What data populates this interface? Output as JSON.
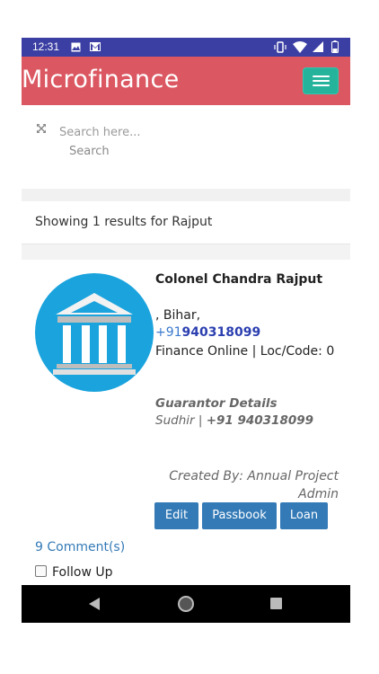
{
  "status_bar": {
    "time": "12:31",
    "left_icons": [
      "image-icon",
      "gmail-icon"
    ],
    "right_icons": [
      "vibrate-icon",
      "wifi-icon",
      "signal-icon",
      "battery-icon"
    ]
  },
  "app_bar": {
    "brand": "Microfinance",
    "menu_icon": "hamburger-menu-icon",
    "bg_color": "#db5761",
    "menu_color": "#26b39c"
  },
  "search": {
    "placeholder": "Search here...",
    "button_label": "Search",
    "icon": "expand-icon"
  },
  "results": {
    "summary": "Showing 1 results for Rajput"
  },
  "customer": {
    "avatar_icon": "bank-building-icon",
    "name": "Colonel Chandra Rajput",
    "address": ", Bihar,",
    "phone_prefix": "+91",
    "phone_number": "940318099",
    "finance_info": "Finance Online | Loc/Code: 0",
    "guarantor_heading": "Guarantor Details",
    "guarantor_name": "Sudhir | ",
    "guarantor_phone": "+91 940318099",
    "created_by": "Created By: Annual Project Admin",
    "actions": [
      "Edit",
      "Passbook",
      "Loan"
    ],
    "comments": "9 Comment(s)",
    "follow_up": "Follow Up"
  },
  "nav_bar": {
    "icons": [
      "back-icon",
      "home-icon",
      "recent-apps-icon"
    ]
  }
}
